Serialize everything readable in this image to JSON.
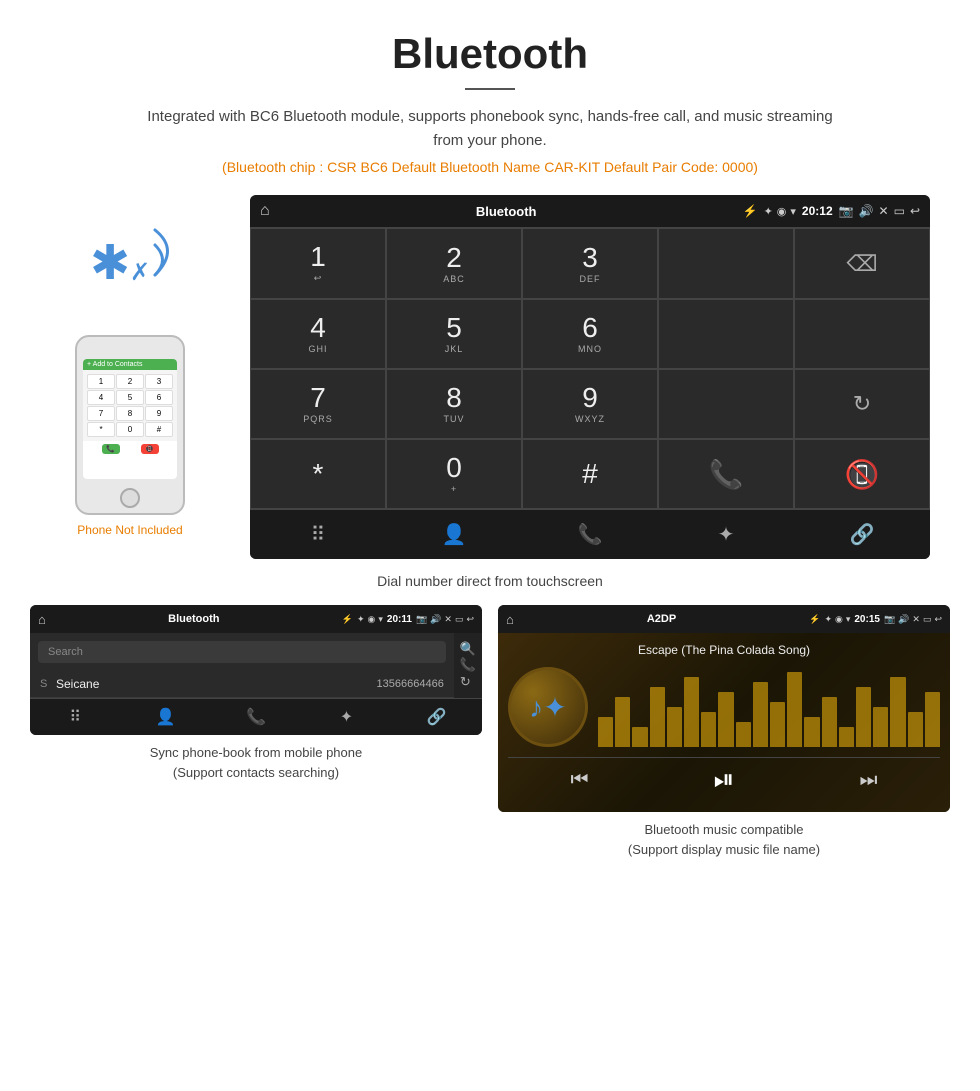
{
  "header": {
    "title": "Bluetooth",
    "description": "Integrated with BC6 Bluetooth module, supports phonebook sync, hands-free call, and music streaming from your phone.",
    "specs": "(Bluetooth chip : CSR BC6    Default Bluetooth Name CAR-KIT    Default Pair Code: 0000)"
  },
  "dial_screen": {
    "statusbar": {
      "home_icon": "⌂",
      "title": "Bluetooth",
      "usb_icon": "⚡",
      "bt_icon": "✦",
      "location_icon": "◉",
      "signal_icon": "▾",
      "time": "20:12",
      "camera_icon": "📷",
      "volume_icon": "🔊",
      "close_icon": "✕",
      "window_icon": "▭",
      "back_icon": "↩"
    },
    "keys": [
      {
        "num": "1",
        "sub": "↩"
      },
      {
        "num": "2",
        "sub": "ABC"
      },
      {
        "num": "3",
        "sub": "DEF"
      },
      {
        "num": "",
        "sub": ""
      },
      {
        "num": "⌫",
        "sub": ""
      },
      {
        "num": "4",
        "sub": "GHI"
      },
      {
        "num": "5",
        "sub": "JKL"
      },
      {
        "num": "6",
        "sub": "MNO"
      },
      {
        "num": "",
        "sub": ""
      },
      {
        "num": "",
        "sub": ""
      },
      {
        "num": "7",
        "sub": "PQRS"
      },
      {
        "num": "8",
        "sub": "TUV"
      },
      {
        "num": "9",
        "sub": "WXYZ"
      },
      {
        "num": "",
        "sub": ""
      },
      {
        "num": "↻",
        "sub": ""
      },
      {
        "num": "*",
        "sub": ""
      },
      {
        "num": "0",
        "sub": "+"
      },
      {
        "num": "#",
        "sub": ""
      },
      {
        "num": "📞",
        "sub": "call"
      },
      {
        "num": "📵",
        "sub": "end"
      }
    ],
    "bottom_nav": [
      "⠿",
      "👤",
      "📞",
      "✦",
      "🔗"
    ]
  },
  "dial_caption": "Dial number direct from touchscreen",
  "phonebook_screen": {
    "statusbar": {
      "home_icon": "⌂",
      "title": "Bluetooth",
      "usb_icon": "⚡",
      "bt_icon": "✦",
      "location_icon": "◉",
      "signal_icon": "▾",
      "time": "20:11",
      "camera_icon": "📷",
      "volume_icon": "🔊",
      "close_icon": "✕",
      "window_icon": "▭",
      "back_icon": "↩"
    },
    "search_placeholder": "Search",
    "contacts": [
      {
        "letter": "S",
        "name": "Seicane",
        "number": "13566664466"
      }
    ],
    "side_icons": [
      "🔍",
      "📞",
      "↻"
    ],
    "bottom_nav": [
      "⠿",
      "👤",
      "📞",
      "✦",
      "🔗"
    ]
  },
  "music_screen": {
    "statusbar": {
      "home_icon": "⌂",
      "title": "A2DP",
      "usb_icon": "⚡",
      "bt_icon": "✦",
      "location_icon": "◉",
      "signal_icon": "▾",
      "time": "20:15",
      "camera_icon": "📷",
      "volume_icon": "🔊",
      "close_icon": "✕",
      "window_icon": "▭",
      "back_icon": "↩"
    },
    "song_title": "Escape (The Pina Colada Song)",
    "viz_heights": [
      30,
      50,
      20,
      60,
      40,
      70,
      35,
      55,
      25,
      65,
      45,
      75,
      30,
      50,
      20,
      60,
      40,
      70,
      35,
      55
    ],
    "controls": [
      "⏮",
      "⏯",
      "⏭"
    ]
  },
  "phonebook_caption": "Sync phone-book from mobile phone\n(Support contacts searching)",
  "music_caption": "Bluetooth music compatible\n(Support display music file name)",
  "phone_not_included": "Phone Not Included"
}
